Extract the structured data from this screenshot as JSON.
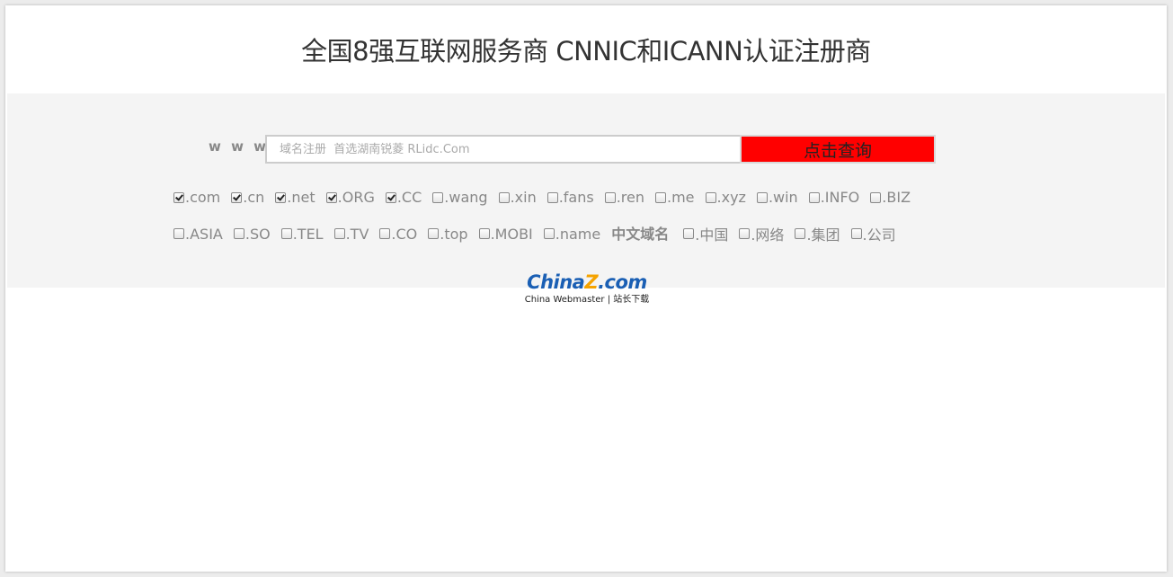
{
  "header": {
    "title": "全国8强互联网服务商 CNNIC和ICANN认证注册商"
  },
  "search": {
    "prefix_label": "w w w .",
    "placeholder": "域名注册  首选湖南锐菱 RLidc.Com",
    "value": "",
    "submit_label": "点击查询"
  },
  "tlds": {
    "row1": [
      {
        "label": ".com",
        "checked": true
      },
      {
        "label": ".cn",
        "checked": true
      },
      {
        "label": ".net",
        "checked": true
      },
      {
        "label": ".ORG",
        "checked": true
      },
      {
        "label": ".CC",
        "checked": true
      },
      {
        "label": ".wang",
        "checked": false
      },
      {
        "label": ".xin",
        "checked": false
      },
      {
        "label": ".fans",
        "checked": false
      },
      {
        "label": ".ren",
        "checked": false
      },
      {
        "label": ".me",
        "checked": false
      },
      {
        "label": ".xyz",
        "checked": false
      },
      {
        "label": ".win",
        "checked": false
      },
      {
        "label": ".INFO",
        "checked": false
      },
      {
        "label": ".BIZ",
        "checked": false
      }
    ],
    "row2": [
      {
        "label": ".ASIA",
        "checked": false
      },
      {
        "label": ".SO",
        "checked": false
      },
      {
        "label": ".TEL",
        "checked": false
      },
      {
        "label": ".TV",
        "checked": false
      },
      {
        "label": ".CO",
        "checked": false
      },
      {
        "label": ".top",
        "checked": false
      },
      {
        "label": ".MOBI",
        "checked": false
      },
      {
        "label": ".name",
        "checked": false
      }
    ],
    "chinese_heading": "中文域名",
    "row2_chinese": [
      {
        "label": ".中国",
        "checked": false
      },
      {
        "label": ".网络",
        "checked": false
      },
      {
        "label": ".集团",
        "checked": false
      },
      {
        "label": ".公司",
        "checked": false
      }
    ]
  },
  "logo": {
    "brand_left": "China",
    "brand_z": "Z",
    "brand_right": ".com",
    "tagline": "China Webmaster | 站长下载"
  },
  "colors": {
    "button_bg": "#ff0000",
    "panel_bg": "#f4f4f4",
    "logo_blue": "#1a5fb4",
    "logo_orange": "#f5a300"
  }
}
